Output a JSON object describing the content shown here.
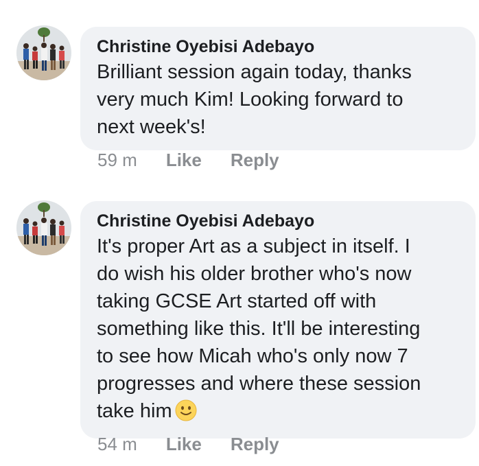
{
  "comments": [
    {
      "author": "Christine Oyebisi Adebayo",
      "text_lines": [
        "Brilliant session again today, thanks",
        "very much Kim! Looking forward to",
        "next week's!"
      ],
      "time": "59 m",
      "like_label": "Like",
      "reply_label": "Reply"
    },
    {
      "author": "Christine Oyebisi Adebayo",
      "text_lines": [
        "It's proper Art as a subject in itself. I",
        "do wish his older brother who's now",
        "taking GCSE Art started off with",
        "something like this. It'll be interesting",
        "to see how Micah who's only now 7",
        "progresses and where these session",
        "take him"
      ],
      "emoji": "slightly-smiling-face-icon",
      "time": "54 m",
      "like_label": "Like",
      "reply_label": "Reply"
    }
  ],
  "colors": {
    "bubble": "#f0f2f5",
    "text": "#1c1e21",
    "meta": "#8a8d91"
  }
}
